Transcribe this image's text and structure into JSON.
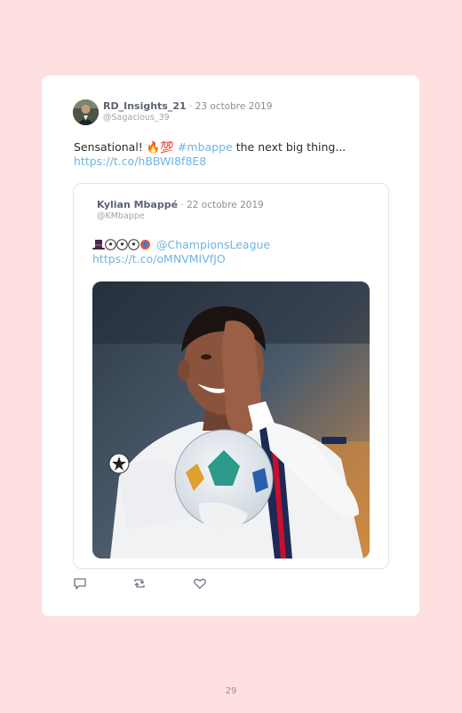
{
  "tweet": {
    "author_name": "RD_Insights_21",
    "date": "23 octobre 2019",
    "handle": "@Sagacious_39",
    "text_plain": "Sensational!",
    "emoji": "🔥💯",
    "hashtag": "#mbappe",
    "text_after": "the next big thing...",
    "link": "https://t.co/hBBWI8f8E8"
  },
  "quoted_tweet": {
    "author_name": "Kylian Mbappé",
    "date": "22 octobre 2019",
    "handle": "@KMbappe",
    "emoji_icons": [
      "top-hat-icon",
      "soccer-ball-icon",
      "soccer-ball-icon",
      "soccer-ball-icon",
      "gem-icon"
    ],
    "mention": "@ChampionsLeague",
    "link": "https://t.co/oMNVMIVfJO",
    "photo_description": "player-celebrating-with-ball"
  },
  "separator": "·",
  "page_number": "29",
  "colors": {
    "background": "#fde0df",
    "card": "#ffffff",
    "link": "#6fb5e2",
    "text": "#2b2b2b"
  },
  "actions": [
    "reply-icon",
    "retweet-icon",
    "like-icon"
  ]
}
